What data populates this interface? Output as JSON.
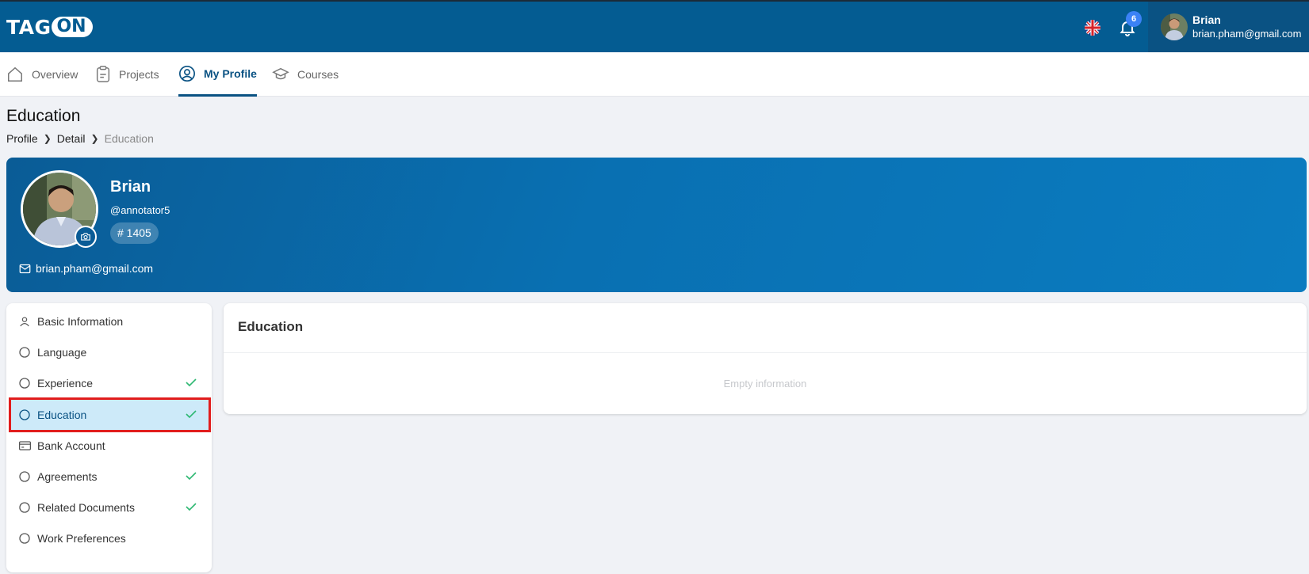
{
  "header": {
    "logo_text_a": "TAG",
    "logo_text_b": "ON",
    "notification_count": "6",
    "user_name": "Brian",
    "user_email": "brian.pham@gmail.com"
  },
  "nav": {
    "tabs": [
      {
        "label": "Overview",
        "icon": "home-icon"
      },
      {
        "label": "Projects",
        "icon": "clipboard-icon"
      },
      {
        "label": "My Profile",
        "icon": "user-circle-icon",
        "active": true
      },
      {
        "label": "Courses",
        "icon": "graduation-cap-icon"
      }
    ]
  },
  "page": {
    "title": "Education",
    "breadcrumb": [
      "Profile",
      "Detail",
      "Education"
    ]
  },
  "profile": {
    "name": "Brian",
    "handle": "@annotator5",
    "id_label": "# 1405",
    "email": "brian.pham@gmail.com"
  },
  "sidebar": {
    "items": [
      {
        "label": "Basic Information",
        "icon": "user-icon",
        "checked": false
      },
      {
        "label": "Language",
        "icon": "circle-icon",
        "checked": false
      },
      {
        "label": "Experience",
        "icon": "circle-icon",
        "checked": true
      },
      {
        "label": "Education",
        "icon": "circle-icon",
        "checked": true,
        "active": true
      },
      {
        "label": "Bank Account",
        "icon": "credit-card-icon",
        "checked": false
      },
      {
        "label": "Agreements",
        "icon": "circle-icon",
        "checked": true
      },
      {
        "label": "Related Documents",
        "icon": "circle-icon",
        "checked": true
      },
      {
        "label": "Work Preferences",
        "icon": "circle-icon",
        "checked": false
      }
    ]
  },
  "content": {
    "title": "Education",
    "empty_text": "Empty information"
  },
  "colors": {
    "header_bg": "#045c92",
    "accent": "#0a5283",
    "active_item_bg": "#cdeaf9",
    "highlight_outline": "#e11d1d",
    "check": "#2eb872"
  }
}
